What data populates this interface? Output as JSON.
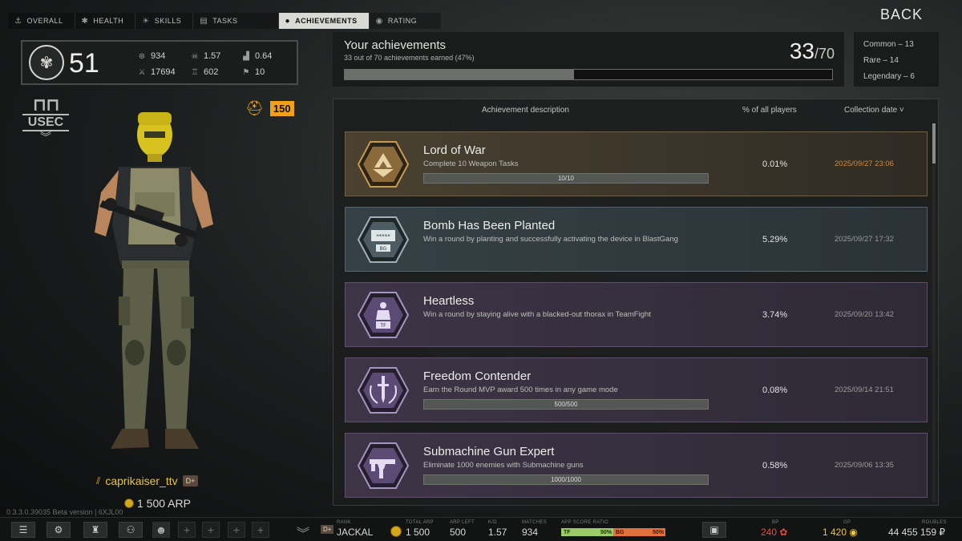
{
  "nav": {
    "tabs": [
      {
        "label": "OVERALL",
        "icon": "anchor-icon"
      },
      {
        "label": "HEALTH",
        "icon": "medical-icon"
      },
      {
        "label": "SKILLS",
        "icon": "bulb-icon"
      },
      {
        "label": "TASKS",
        "icon": "clipboard-icon"
      },
      {
        "label": "ACHIEVEMENTS",
        "icon": "medal-icon"
      },
      {
        "label": "RATING",
        "icon": "rating-icon"
      }
    ],
    "active": "ACHIEVEMENTS",
    "back_label": "BACK"
  },
  "profile": {
    "level": "51",
    "stats": {
      "kills": "934",
      "deaths": "17694",
      "kd": "1.57",
      "mvp": "602",
      "ratio": "0.64",
      "badges": "10"
    },
    "faction": "USEC",
    "prestige": "150",
    "username": "caprikaiser_ttv",
    "rank_badge": "D+",
    "arp": "1 500 ARP"
  },
  "version": "0.3.3.0.39035 Beta version | 6XJL00",
  "achievements": {
    "title": "Your achievements",
    "subtitle": "33 out of 70 achievements earned (47%)",
    "earned": "33",
    "total": "/70",
    "progress_fraction": 0.47,
    "rarity": {
      "common": "Common – 13",
      "rare": "Rare – 14",
      "legendary": "Legendary – 6"
    },
    "columns": {
      "description": "Achievement description",
      "percent": "% of all players",
      "date": "Collection date ˅"
    },
    "items": [
      {
        "name": "Lord of War",
        "desc": "Complete 10 Weapon Tasks",
        "progress": "10/10",
        "progress_fraction": 1.0,
        "percent": "0.01%",
        "date": "2025/09/27 23:06",
        "rarity": "legendary-gold",
        "icon": "lord-of-war-icon"
      },
      {
        "name": "Bomb Has Been Planted",
        "desc": "Win a round by planting and successfully activating the device in BlastGang",
        "progress": "",
        "progress_fraction": null,
        "percent": "5.29%",
        "date": "2025/09/27 17:32",
        "rarity": "rare",
        "icon": "bomb-planted-icon"
      },
      {
        "name": "Heartless",
        "desc": "Win a round by staying alive with a blacked-out thorax in TeamFight",
        "progress": "",
        "progress_fraction": null,
        "percent": "3.74%",
        "date": "2025/09/20 13:42",
        "rarity": "legendary",
        "icon": "heartless-icon"
      },
      {
        "name": "Freedom Contender",
        "desc": "Earn the Round MVP award 500 times in any game mode",
        "progress": "500/500",
        "progress_fraction": 1.0,
        "percent": "0.08%",
        "date": "2025/09/14 21:51",
        "rarity": "legendary",
        "icon": "freedom-contender-icon"
      },
      {
        "name": "Submachine Gun Expert",
        "desc": "Eliminate 1000 enemies with Submachine guns",
        "progress": "1000/1000",
        "progress_fraction": 1.0,
        "percent": "0.58%",
        "date": "2025/09/06 13:35",
        "rarity": "legendary",
        "icon": "smg-icon"
      }
    ]
  },
  "bottombar": {
    "rank_label": "RANK",
    "rank_badge": "D+",
    "rank_name": "JACKAL",
    "total_arp_label": "TOTAL ARP",
    "total_arp": "1 500",
    "arp_left_label": "ARP LEFT",
    "arp_left": "500",
    "kd_label": "K/D",
    "kd": "1.57",
    "matches_label": "MATCHES",
    "matches": "934",
    "ratio_label": "APP SCORE RATIO",
    "ratio_tf_label": "TF",
    "ratio_tf": "50%",
    "ratio_bg_label": "BG",
    "ratio_bg": "50%",
    "bp_label": "BP",
    "bp": "240",
    "gp_label": "GP",
    "gp": "1 420",
    "roubles_label": "ROUBLES",
    "roubles": "44 455 159 ₽"
  },
  "colors": {
    "accent_orange": "#f0a11a",
    "username_gold": "#e6c544",
    "date_highlight": "#d08a3a",
    "bp_red": "#e0503c",
    "gp_gold": "#e6c544"
  }
}
